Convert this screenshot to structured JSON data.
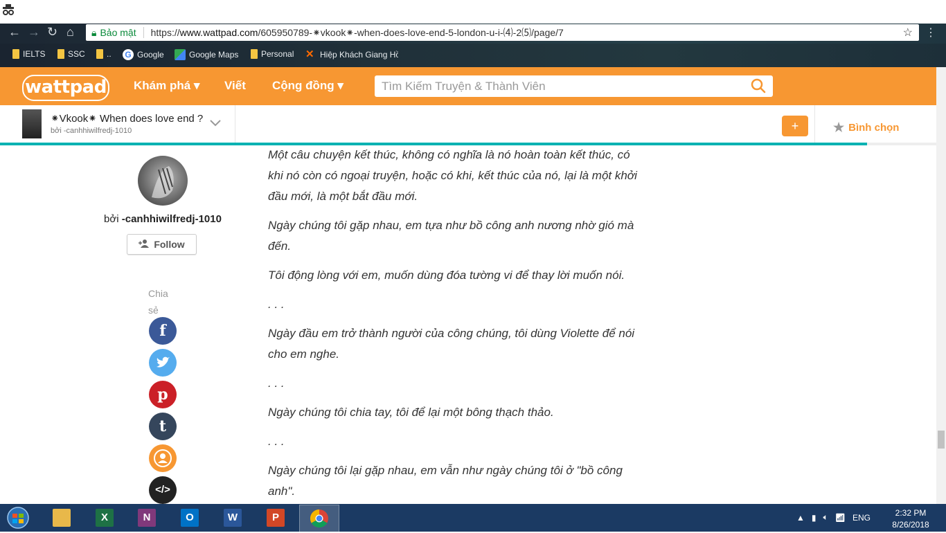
{
  "browser": {
    "security_label": "Bảo mật",
    "url_prefix": "https://",
    "url_domain": "www.wattpad.com",
    "url_path": "/605950789-⁕vkook⁕-when-does-love-end-5-london-u-i-⑷-2⑸/page/7",
    "bookmarks": [
      {
        "label": "IELTS",
        "icon": "folder-icon"
      },
      {
        "label": "SSC",
        "icon": "folder-icon"
      },
      {
        "label": "..",
        "icon": "folder-icon"
      },
      {
        "label": "Google",
        "icon": "google-icon"
      },
      {
        "label": "Google Maps",
        "icon": "maps-icon"
      },
      {
        "label": "Personal",
        "icon": "folder-icon"
      },
      {
        "label": "Hiệp Khách Giang Hồ",
        "icon": "game-icon"
      }
    ]
  },
  "header": {
    "logo": "wattpad",
    "nav": [
      {
        "label": "Khám phá ▾"
      },
      {
        "label": "Viết"
      },
      {
        "label": "Cộng đồng ▾"
      }
    ],
    "search_placeholder": "Tìm Kiếm Truyện & Thành Viên"
  },
  "story_bar": {
    "title": "⁕Vkook⁕ When does love end ?",
    "author": "bởi -canhhiwilfredj-1010",
    "add_label": "+",
    "vote_label": "Bình chọn"
  },
  "sidebar": {
    "by": "bởi ",
    "author": "-canhhiwilfredj-1010",
    "follow_label": "Follow",
    "share_label": "Chia sẻ",
    "share_buttons": [
      {
        "label": "f",
        "color": "#3b5998",
        "icon": "facebook-icon"
      },
      {
        "label": "t",
        "color": "#55acee",
        "icon": "twitter-icon"
      },
      {
        "label": "p",
        "color": "#cb2027",
        "icon": "pinterest-icon"
      },
      {
        "label": "t",
        "color": "#35465c",
        "icon": "tumblr-icon"
      },
      {
        "label": "",
        "color": "#f79732",
        "icon": "user-icon"
      },
      {
        "label": "</>",
        "color": "#222222",
        "icon": "embed-icon"
      }
    ]
  },
  "story": {
    "paragraphs": [
      "Một câu chuyện kết thúc, không có nghĩa là nó hoàn toàn kết thúc, có khi nó còn có ngoại truyện, hoặc có khi, kết thúc của nó, lại là một khởi đầu mới, là một bắt đầu mới.",
      "Ngày chúng tôi gặp nhau, em tựa như bồ công anh nương nhờ gió mà đến.",
      "Tôi động lòng với em, muốn dùng đóa tường vi để thay lời muốn nói.",
      ". . .",
      "Ngày đầu em trở thành người của công chúng, tôi dùng Violette để nói cho em nghe.",
      ". . .",
      "Ngày chúng tôi chia tay, tôi để lại một bông thạch thảo.",
      ". . .",
      "Ngày chúng tôi lại gặp nhau, em vẫn như ngày chúng tôi ở \"bồ công anh\"."
    ]
  },
  "taskbar": {
    "apps": [
      {
        "label": "",
        "color": "#e8b84a",
        "icon": "file-explorer-icon"
      },
      {
        "label": "X",
        "color": "#1e7145",
        "icon": "excel-icon"
      },
      {
        "label": "N",
        "color": "#80397b",
        "icon": "onenote-icon"
      },
      {
        "label": "O",
        "color": "#0072c6",
        "icon": "outlook-icon"
      },
      {
        "label": "W",
        "color": "#2b579a",
        "icon": "word-icon"
      },
      {
        "label": "P",
        "color": "#d24726",
        "icon": "powerpoint-icon"
      },
      {
        "label": "",
        "color": "#4285f4",
        "icon": "chrome-icon"
      }
    ],
    "lang": "ENG",
    "time": "2:32 PM",
    "date": "8/26/2018"
  }
}
